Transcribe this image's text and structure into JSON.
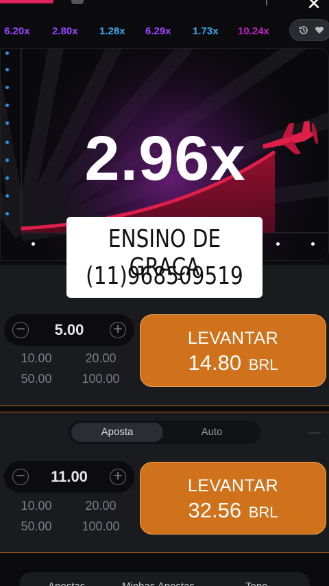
{
  "history": {
    "multipliers": [
      "6.20x",
      "2.80x",
      "1.28x",
      "6.29x",
      "1.73x",
      "10.24x"
    ]
  },
  "game": {
    "current_multiplier": "2.96x"
  },
  "watermark": {
    "line1": "ENSINO DE GRAÇA",
    "line2": "(11)968509519"
  },
  "bet1": {
    "amount": "5.00",
    "quick": [
      "10.00",
      "20.00",
      "50.00",
      "100.00"
    ],
    "cashout_label": "LEVANTAR",
    "cashout_value": "14.80",
    "currency": "BRL"
  },
  "bet2": {
    "tabs": [
      "Aposta",
      "Auto"
    ],
    "amount": "11.00",
    "quick": [
      "10.00",
      "20.00",
      "50.00",
      "100.00"
    ],
    "cashout_label": "LEVANTAR",
    "cashout_value": "32.56",
    "currency": "BRL"
  },
  "bottom_tabs": [
    "Apostas",
    "Minhas Apostas",
    "Topo"
  ],
  "colors": {
    "accent_orange": "#d0721b",
    "plane_red": "#e01e4a",
    "history_purple": "#9c43ff",
    "history_blue": "#3aa6e8"
  }
}
